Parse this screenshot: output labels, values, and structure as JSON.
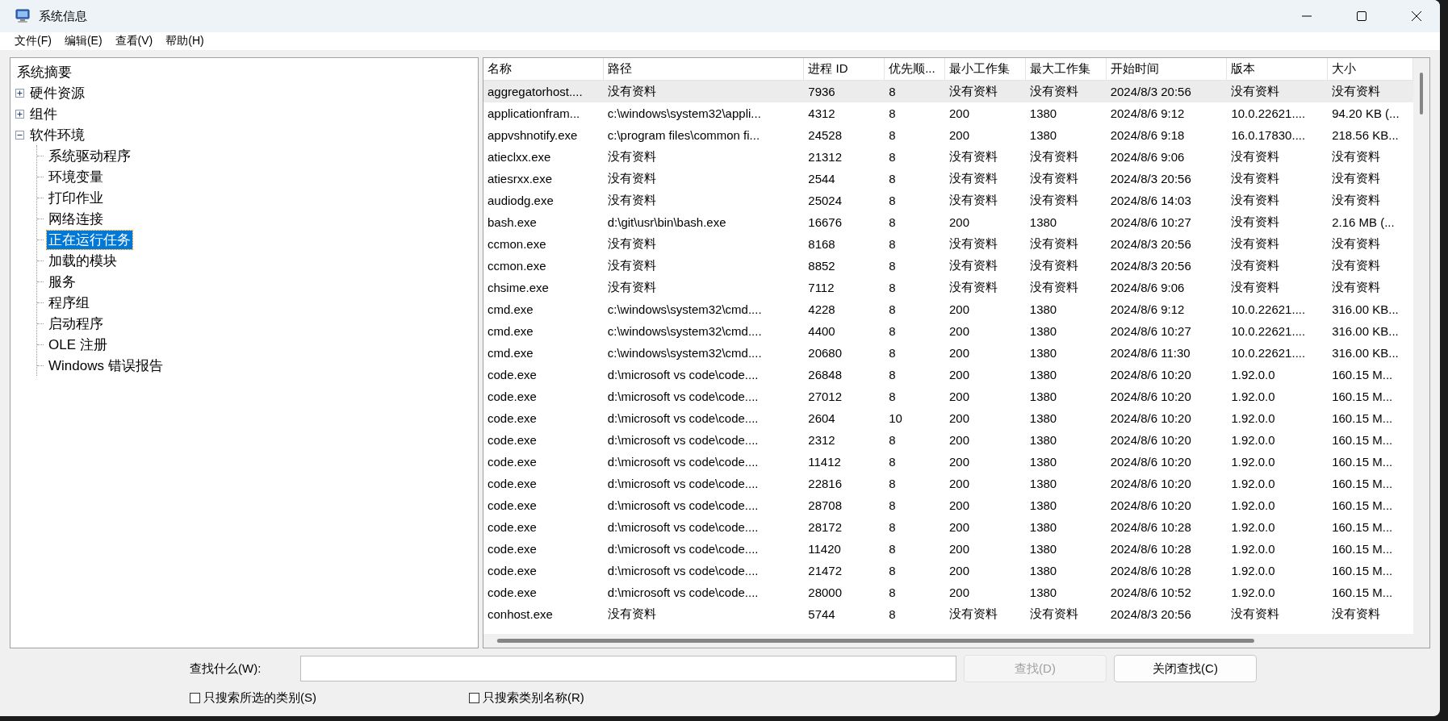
{
  "window": {
    "title": "系统信息"
  },
  "menu": [
    "文件(F)",
    "编辑(E)",
    "查看(V)",
    "帮助(H)"
  ],
  "tree": {
    "items": [
      {
        "label": "系统摘要",
        "selected": false
      },
      {
        "label": "硬件资源",
        "selected": false,
        "expanded": false
      },
      {
        "label": "组件",
        "selected": false,
        "expanded": false
      },
      {
        "label": "软件环境",
        "selected": false,
        "expanded": true,
        "children": [
          {
            "label": "系统驱动程序",
            "selected": false
          },
          {
            "label": "环境变量",
            "selected": false
          },
          {
            "label": "打印作业",
            "selected": false
          },
          {
            "label": "网络连接",
            "selected": false
          },
          {
            "label": "正在运行任务",
            "selected": true
          },
          {
            "label": "加载的模块",
            "selected": false
          },
          {
            "label": "服务",
            "selected": false
          },
          {
            "label": "程序组",
            "selected": false
          },
          {
            "label": "启动程序",
            "selected": false
          },
          {
            "label": "OLE 注册",
            "selected": false
          },
          {
            "label": "Windows 错误报告",
            "selected": false
          }
        ]
      }
    ]
  },
  "table": {
    "columns": [
      "名称",
      "路径",
      "进程 ID",
      "优先顺...",
      "最小工作集",
      "最大工作集",
      "开始时间",
      "版本",
      "大小"
    ],
    "rows": [
      {
        "selected": true,
        "cells": [
          "aggregatorhost....",
          "没有资料",
          "7936",
          "8",
          "没有资料",
          "没有资料",
          "2024/8/3 20:56",
          "没有资料",
          "没有资料"
        ]
      },
      {
        "selected": false,
        "cells": [
          "applicationfram...",
          "c:\\windows\\system32\\appli...",
          "4312",
          "8",
          "200",
          "1380",
          "2024/8/6 9:12",
          "10.0.22621....",
          "94.20 KB (..."
        ]
      },
      {
        "selected": false,
        "cells": [
          "appvshnotify.exe",
          "c:\\program files\\common fi...",
          "24528",
          "8",
          "200",
          "1380",
          "2024/8/6 9:18",
          "16.0.17830....",
          "218.56 KB..."
        ]
      },
      {
        "selected": false,
        "cells": [
          "atieclxx.exe",
          "没有资料",
          "21312",
          "8",
          "没有资料",
          "没有资料",
          "2024/8/6 9:06",
          "没有资料",
          "没有资料"
        ]
      },
      {
        "selected": false,
        "cells": [
          "atiesrxx.exe",
          "没有资料",
          "2544",
          "8",
          "没有资料",
          "没有资料",
          "2024/8/3 20:56",
          "没有资料",
          "没有资料"
        ]
      },
      {
        "selected": false,
        "cells": [
          "audiodg.exe",
          "没有资料",
          "25024",
          "8",
          "没有资料",
          "没有资料",
          "2024/8/6 14:03",
          "没有资料",
          "没有资料"
        ]
      },
      {
        "selected": false,
        "cells": [
          "bash.exe",
          "d:\\git\\usr\\bin\\bash.exe",
          "16676",
          "8",
          "200",
          "1380",
          "2024/8/6 10:27",
          "没有资料",
          "2.16 MB (..."
        ]
      },
      {
        "selected": false,
        "cells": [
          "ccmon.exe",
          "没有资料",
          "8168",
          "8",
          "没有资料",
          "没有资料",
          "2024/8/3 20:56",
          "没有资料",
          "没有资料"
        ]
      },
      {
        "selected": false,
        "cells": [
          "ccmon.exe",
          "没有资料",
          "8852",
          "8",
          "没有资料",
          "没有资料",
          "2024/8/3 20:56",
          "没有资料",
          "没有资料"
        ]
      },
      {
        "selected": false,
        "cells": [
          "chsime.exe",
          "没有资料",
          "7112",
          "8",
          "没有资料",
          "没有资料",
          "2024/8/6 9:06",
          "没有资料",
          "没有资料"
        ]
      },
      {
        "selected": false,
        "cells": [
          "cmd.exe",
          "c:\\windows\\system32\\cmd....",
          "4228",
          "8",
          "200",
          "1380",
          "2024/8/6 9:12",
          "10.0.22621....",
          "316.00 KB..."
        ]
      },
      {
        "selected": false,
        "cells": [
          "cmd.exe",
          "c:\\windows\\system32\\cmd....",
          "4400",
          "8",
          "200",
          "1380",
          "2024/8/6 10:27",
          "10.0.22621....",
          "316.00 KB..."
        ]
      },
      {
        "selected": false,
        "cells": [
          "cmd.exe",
          "c:\\windows\\system32\\cmd....",
          "20680",
          "8",
          "200",
          "1380",
          "2024/8/6 11:30",
          "10.0.22621....",
          "316.00 KB..."
        ]
      },
      {
        "selected": false,
        "cells": [
          "code.exe",
          "d:\\microsoft vs code\\code....",
          "26848",
          "8",
          "200",
          "1380",
          "2024/8/6 10:20",
          "1.92.0.0",
          "160.15 M..."
        ]
      },
      {
        "selected": false,
        "cells": [
          "code.exe",
          "d:\\microsoft vs code\\code....",
          "27012",
          "8",
          "200",
          "1380",
          "2024/8/6 10:20",
          "1.92.0.0",
          "160.15 M..."
        ]
      },
      {
        "selected": false,
        "cells": [
          "code.exe",
          "d:\\microsoft vs code\\code....",
          "2604",
          "10",
          "200",
          "1380",
          "2024/8/6 10:20",
          "1.92.0.0",
          "160.15 M..."
        ]
      },
      {
        "selected": false,
        "cells": [
          "code.exe",
          "d:\\microsoft vs code\\code....",
          "2312",
          "8",
          "200",
          "1380",
          "2024/8/6 10:20",
          "1.92.0.0",
          "160.15 M..."
        ]
      },
      {
        "selected": false,
        "cells": [
          "code.exe",
          "d:\\microsoft vs code\\code....",
          "11412",
          "8",
          "200",
          "1380",
          "2024/8/6 10:20",
          "1.92.0.0",
          "160.15 M..."
        ]
      },
      {
        "selected": false,
        "cells": [
          "code.exe",
          "d:\\microsoft vs code\\code....",
          "22816",
          "8",
          "200",
          "1380",
          "2024/8/6 10:20",
          "1.92.0.0",
          "160.15 M..."
        ]
      },
      {
        "selected": false,
        "cells": [
          "code.exe",
          "d:\\microsoft vs code\\code....",
          "28708",
          "8",
          "200",
          "1380",
          "2024/8/6 10:20",
          "1.92.0.0",
          "160.15 M..."
        ]
      },
      {
        "selected": false,
        "cells": [
          "code.exe",
          "d:\\microsoft vs code\\code....",
          "28172",
          "8",
          "200",
          "1380",
          "2024/8/6 10:28",
          "1.92.0.0",
          "160.15 M..."
        ]
      },
      {
        "selected": false,
        "cells": [
          "code.exe",
          "d:\\microsoft vs code\\code....",
          "11420",
          "8",
          "200",
          "1380",
          "2024/8/6 10:28",
          "1.92.0.0",
          "160.15 M..."
        ]
      },
      {
        "selected": false,
        "cells": [
          "code.exe",
          "d:\\microsoft vs code\\code....",
          "21472",
          "8",
          "200",
          "1380",
          "2024/8/6 10:28",
          "1.92.0.0",
          "160.15 M..."
        ]
      },
      {
        "selected": false,
        "cells": [
          "code.exe",
          "d:\\microsoft vs code\\code....",
          "28000",
          "8",
          "200",
          "1380",
          "2024/8/6 10:52",
          "1.92.0.0",
          "160.15 M..."
        ]
      },
      {
        "selected": false,
        "cells": [
          "conhost.exe",
          "没有资料",
          "5744",
          "8",
          "没有资料",
          "没有资料",
          "2024/8/3 20:56",
          "没有资料",
          "没有资料"
        ]
      }
    ]
  },
  "find": {
    "label": "查找什么(W):",
    "find_button": {
      "label": "查找(D)",
      "disabled": true
    },
    "close_button": {
      "label": "关闭查找(C)",
      "disabled": false
    },
    "options": [
      {
        "label": "只搜索所选的类别(S)",
        "checked": false
      },
      {
        "label": "只搜索类别名称(R)",
        "checked": false
      }
    ]
  }
}
